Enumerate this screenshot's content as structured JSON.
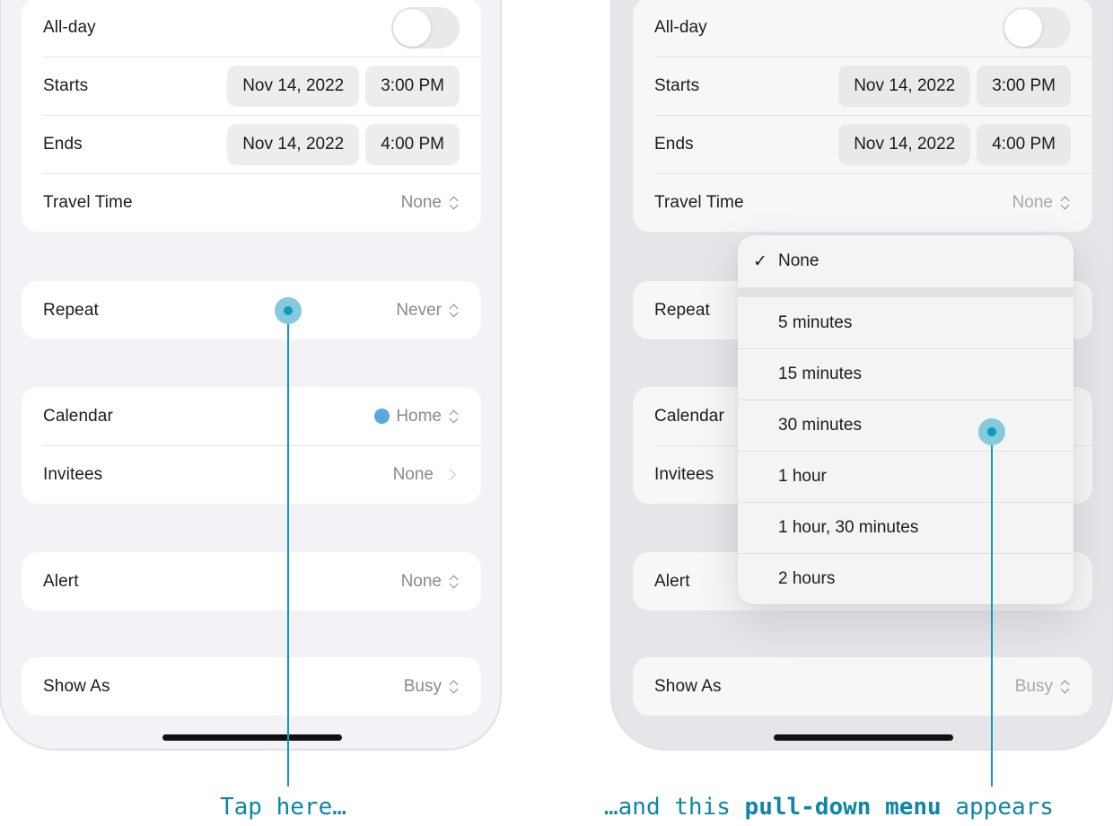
{
  "event_form": {
    "all_day": {
      "label": "All-day",
      "on": false
    },
    "starts": {
      "label": "Starts",
      "date": "Nov 14, 2022",
      "time": "3:00 PM"
    },
    "ends": {
      "label": "Ends",
      "date": "Nov 14, 2022",
      "time": "4:00 PM"
    },
    "travel_time": {
      "label": "Travel Time",
      "value": "None"
    },
    "repeat": {
      "label": "Repeat",
      "value": "Never"
    },
    "calendar": {
      "label": "Calendar",
      "value": "Home",
      "color": "#5aa7dc"
    },
    "invitees": {
      "label": "Invitees",
      "value": "None"
    },
    "alert": {
      "label": "Alert",
      "value": "None"
    },
    "show_as": {
      "label": "Show As",
      "value": "Busy"
    }
  },
  "travel_menu": {
    "selected": "None",
    "check_glyph": "✓",
    "items": [
      "None",
      "5 minutes",
      "15 minutes",
      "30 minutes",
      "1 hour",
      "1 hour, 30 minutes",
      "2 hours"
    ]
  },
  "annotations": {
    "left_caption": "Tap here…",
    "right_caption_pre": "…and this ",
    "right_caption_bold": "pull-down menu",
    "right_caption_post": " appears",
    "accent_color": "#0f99be"
  }
}
